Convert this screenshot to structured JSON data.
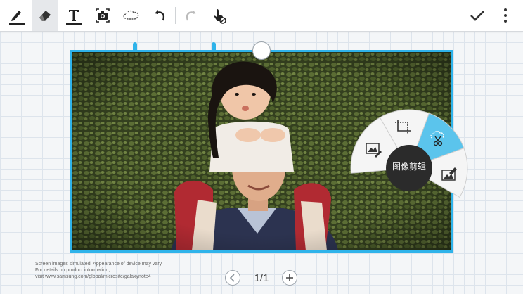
{
  "toolbar": {
    "tools": [
      {
        "name": "pen-tool",
        "icon": "pen-icon",
        "active": false
      },
      {
        "name": "eraser-tool",
        "icon": "eraser-icon",
        "active": true
      },
      {
        "name": "text-tool",
        "icon": "text-icon",
        "active": false
      },
      {
        "name": "camera-tool",
        "icon": "camera-icon",
        "active": false
      },
      {
        "name": "selection-tool",
        "icon": "lasso-icon",
        "active": false
      },
      {
        "name": "undo-tool",
        "icon": "undo-icon",
        "active": false
      },
      {
        "name": "redo-tool",
        "icon": "redo-icon",
        "active": false,
        "disabled": true
      },
      {
        "name": "touch-mode-tool",
        "icon": "hand-pointer-icon",
        "active": false
      }
    ],
    "confirm_icon": "checkmark-icon",
    "menu_icon": "more-vertical-icon"
  },
  "canvas": {
    "frame_color": "#2fb3ea",
    "image": "photo of a smiling man carrying a young girl on his shoulders in front of an ivy-covered wall"
  },
  "radial_menu": {
    "center_label": "图像剪辑",
    "items": [
      {
        "name": "image-edit",
        "icon": "image-edit-icon",
        "highlighted": false
      },
      {
        "name": "crop",
        "icon": "crop-icon",
        "highlighted": false
      },
      {
        "name": "lasso-cut",
        "icon": "lasso-scissors-icon",
        "highlighted": true
      },
      {
        "name": "image-draw",
        "icon": "image-draw-icon",
        "highlighted": false
      }
    ],
    "highlight_color": "#5bc4ec"
  },
  "footer": {
    "disclaimer_lines": [
      "Screen images simulated. Appearance of device may vary.",
      "For details on product information,",
      "visit www.samsung.com/global/microsite/galaxynote4"
    ],
    "page_indicator": "1/1",
    "prev_icon": "chevron-left-icon",
    "add_icon": "plus-icon"
  }
}
